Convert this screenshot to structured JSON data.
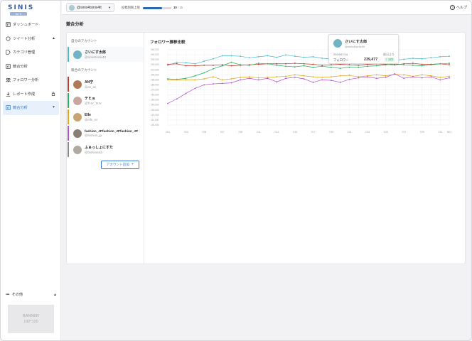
{
  "app": {
    "logo_text": "SINIS",
    "logo_tag": "for X"
  },
  "sidebar": {
    "items": [
      {
        "label": "ダッシュボード",
        "icon": "dashboard-icon",
        "suffix": ""
      },
      {
        "label": "ツイート分析",
        "icon": "chat-icon",
        "suffix": "▲"
      },
      {
        "label": "カテゴリ管理",
        "icon": "tag-icon",
        "suffix": ""
      },
      {
        "label": "競合分析",
        "icon": "chart-icon",
        "suffix": ""
      },
      {
        "label": "フォロワー分析",
        "icon": "users-icon",
        "suffix": ""
      },
      {
        "label": "レポート作成",
        "icon": "download-icon",
        "suffix": "🔒"
      },
      {
        "label": "競合分析",
        "icon": "chart-icon",
        "suffix": "▼",
        "active": true
      }
    ],
    "other_label": "その他",
    "banner_line1": "BANNER",
    "banner_line2": "192*120"
  },
  "topbar": {
    "account": "@sinis4tsinis4tt",
    "limit_label": "投稿制限上限",
    "limit_progress": 0.67,
    "limit_count": "10",
    "limit_total": "/ 15",
    "help": "ヘルプ"
  },
  "page": {
    "title": "競合分析"
  },
  "accounts": {
    "own_label": "自分のアカウント",
    "own": {
      "name": "さいにす太郎",
      "handle": "@sinis4tsinis4tt",
      "color": "#4fb8c5"
    },
    "competitor_label": "競合のアカウント",
    "competitors": [
      {
        "name": "AN宁",
        "handle": "@an_an",
        "color": "#c0392b"
      },
      {
        "name": "テヒョ",
        "handle": "@THY_THY",
        "color": "#27ae60"
      },
      {
        "name": "Elle",
        "handle": "@elle_ex",
        "color": "#e0a51b"
      },
      {
        "name": "fashion_JPfashion_JPfashion_JP",
        "handle": "@fashion_jp",
        "color": "#b44fd0"
      },
      {
        "name": "ふぁっしょにすた",
        "handle": "@fashionista",
        "color": "#888888"
      }
    ],
    "add_button": "アカウント追加"
  },
  "chart_data": {
    "type": "line",
    "title": "フォロワー推移比較",
    "ylim": [
      100000,
      250000
    ],
    "yticks": [
      "250,000",
      "240,000",
      "230,000",
      "220,000",
      "210,000",
      "200,000",
      "190,000",
      "180,000",
      "170,000",
      "160,000",
      "150,000",
      "140,000",
      "130,000",
      "120,000",
      "110,000",
      "100,000"
    ],
    "categories": [
      "7/01",
      "7/02",
      "7/03",
      "7/04",
      "7/05",
      "7/06",
      "7/07",
      "7/08",
      "7/09",
      "7/10",
      "7/11",
      "7/12",
      "7/13",
      "7/14",
      "7/15",
      "7/16",
      "7/17",
      "7/18",
      "7/19",
      "7/20",
      "7/21",
      "7/22",
      "7/23",
      "7/24",
      "7/25",
      "7/26",
      "7/27",
      "7/28",
      "7/29",
      "7/30",
      "7/31",
      "8/01"
    ],
    "tick_labels": [
      "7/01",
      "7/02",
      "7/03",
      "7/04",
      "7/05",
      "7/06",
      "7/07",
      "7/08",
      "7/09",
      "7/10",
      "7/11",
      "7/12",
      "7/13",
      "7/14",
      "7/15",
      "7/16",
      "7/17",
      "7/18",
      "7/19",
      "7/20",
      "7/21",
      "7/22",
      "7/23",
      "7/24",
      "7/25",
      "7/26",
      "7/27",
      "7/28",
      "7/29",
      "7/30",
      "7/31",
      "8/01"
    ],
    "series": [
      {
        "name": "さいにす太郎",
        "color": "#4fb8c5",
        "values": [
          219000,
          225000,
          224000,
          222000,
          227000,
          232000,
          238000,
          238000,
          237000,
          234000,
          236000,
          238000,
          235000,
          239477,
          237000,
          235000,
          236000,
          233000,
          232000,
          231000,
          233000,
          230000,
          231000,
          228000,
          230000,
          229000,
          231000,
          233000,
          232000,
          234000,
          236000,
          237000
        ]
      },
      {
        "name": "AN宁",
        "color": "#c0392b",
        "values": [
          221000,
          222000,
          218000,
          218000,
          219000,
          219000,
          220000,
          218000,
          219000,
          220000,
          221000,
          222000,
          222000,
          222000,
          223000,
          222000,
          221000,
          219000,
          220000,
          221000,
          220000,
          219000,
          221000,
          222000,
          221000,
          220000,
          222000,
          223000,
          221000,
          221000,
          222000,
          220000
        ]
      },
      {
        "name": "テヒョ",
        "color": "#27ae60",
        "values": [
          192000,
          191000,
          193000,
          198000,
          204000,
          212000,
          218000,
          225000,
          220000,
          219000,
          223000,
          222000,
          219000,
          217000,
          216000,
          218000,
          215000,
          217000,
          215000,
          213000,
          215000,
          215000,
          217000,
          218000,
          220000,
          222000,
          220000,
          219000,
          218000,
          220000,
          222000,
          223000
        ]
      },
      {
        "name": "Elle",
        "color": "#e0a51b",
        "values": [
          190000,
          190000,
          190000,
          190000,
          192000,
          196000,
          190000,
          192000,
          195000,
          196000,
          194000,
          195000,
          196000,
          197000,
          200000,
          198000,
          196000,
          195000,
          196000,
          198000,
          199000,
          196000,
          198000,
          200000,
          198000,
          201000,
          200000,
          197000,
          200000,
          198000,
          195000,
          197000
        ]
      },
      {
        "name": "fashion_JPfashion_JPfashion_JP",
        "color": "#b44fd0",
        "values": [
          143000,
          152000,
          163000,
          173000,
          180000,
          182000,
          183000,
          184000,
          190000,
          193000,
          190000,
          193000,
          186000,
          193000,
          195000,
          192000,
          185000,
          190000,
          189000,
          185000,
          191000,
          194000,
          196000,
          193000,
          195000,
          202000,
          193000,
          196000,
          194000,
          196000,
          190000,
          194000
        ]
      }
    ]
  },
  "tooltip": {
    "name": "さいにす太郎",
    "handle": "@sinis4tsinis4tt",
    "date": "2024/07/14",
    "compare_label": "前日より",
    "metric_label": "フォロワー",
    "value": "239,477",
    "diff": "↑ 122"
  }
}
